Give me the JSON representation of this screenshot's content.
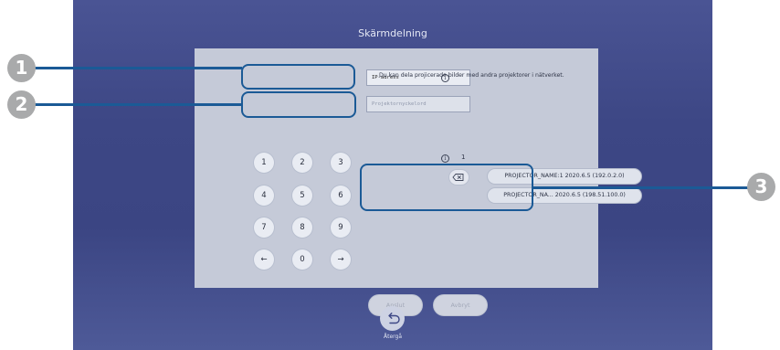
{
  "screen": {
    "title": "Skärmdelning"
  },
  "form": {
    "ip_value": "IP-adress",
    "keyword_placeholder": "Projektornyckelord",
    "info_text": "Du kan dela projicerade bilder med andra projektorer i nätverket.",
    "count": "1"
  },
  "keypad": {
    "k1": "1",
    "k2": "2",
    "k3": "3",
    "k4": "4",
    "k5": "5",
    "k6": "6",
    "k7": "7",
    "k8": "8",
    "k9": "9",
    "k0": "0",
    "left": "←",
    "right": "→"
  },
  "projectors": [
    {
      "label": "PROJECTOR_NAME:1  2020.6.5 (192.0.2.0)"
    },
    {
      "label": "PROJECTOR_NA...  2020.6.5 (198.51.100.0)"
    }
  ],
  "buttons": {
    "connect": "Anslut",
    "cancel": "Avbryt"
  },
  "back": {
    "label": "Återgå"
  },
  "callouts": {
    "c1": "1",
    "c2": "2",
    "c3": "3"
  },
  "icons": {
    "info": "info-icon",
    "backspace": "backspace-icon",
    "back": "return-arrow-icon"
  },
  "colors": {
    "highlight": "#1b5a96",
    "background": "#3d4785",
    "panel": "#c5cad8",
    "callout": "#a9aaab"
  }
}
